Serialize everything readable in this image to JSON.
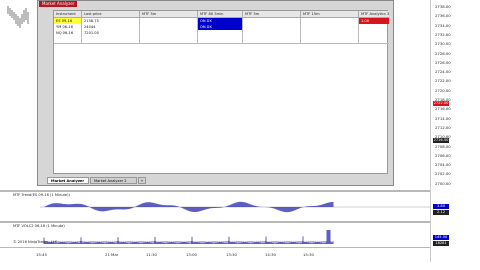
{
  "window": {
    "title": "Market Analyzer"
  },
  "grid": {
    "headers": [
      "Instrument",
      "Last price",
      "MTF 5m",
      "MTF 8X 5min",
      "MTF 5m",
      "MTF 15m",
      "MTF Analytics 30min"
    ],
    "rows": [
      {
        "instrument": "ES 09-16",
        "last": "2158.75",
        "c3": "",
        "c4": "ON DX",
        "c5": "",
        "c6": "",
        "c7": "1.00"
      },
      {
        "instrument": "YM 06-16",
        "last": "24044",
        "c3": "",
        "c4": "ON DX",
        "c5": "",
        "c6": "",
        "c7": ""
      },
      {
        "instrument": "NQ 06-16",
        "last": "7201.00",
        "c3": "",
        "c4": "",
        "c5": "",
        "c6": "",
        "c7": ""
      }
    ]
  },
  "tabs": {
    "active": "Market Analyzer",
    "other": "Market Analyzer 2",
    "add": "+"
  },
  "price_axis": {
    "ticks": [
      "2738.00",
      "2736.00",
      "2734.00",
      "2732.00",
      "2730.00",
      "2728.00",
      "2726.00",
      "2724.00",
      "2722.00",
      "2720.00",
      "2718.00",
      "2716.00",
      "2714.00",
      "2712.00",
      "2710.00",
      "2708.00",
      "2706.00",
      "2704.00",
      "2702.00",
      "2700.00"
    ],
    "badge_red": "2722.00",
    "badge_dark": "2716.50",
    "panel_badge_1": "3.80",
    "panel_badge_2": "2.12",
    "panel_badge_3": "145.50",
    "panel_badge_4": "18281"
  },
  "panels": {
    "p1_label": "MTF Trend(ES 09-16 (1 Minute))",
    "p2_label": "MTF VOLC2 06-16 (1 Minute)",
    "p2_sub": "© 2016 NinjaTrader, LLC"
  },
  "time_axis": [
    "15:45",
    "21 Mar",
    "11:30",
    "13:00",
    "13:30",
    "14:30",
    "15:30"
  ],
  "colors": {
    "accent": "#b0171f",
    "highlight_blue": "#0000cc",
    "highlight_yellow": "#ffff33",
    "volume_blue": "#1a1aa6"
  }
}
